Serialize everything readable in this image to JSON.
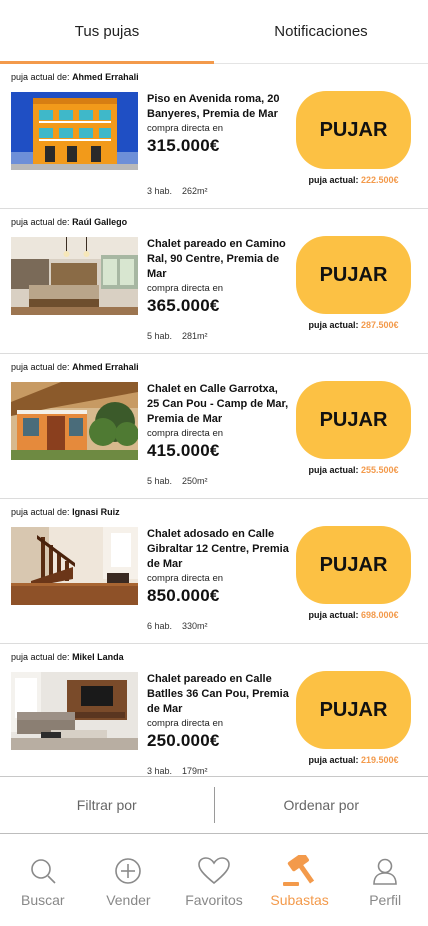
{
  "tabs": [
    {
      "label": "Tus pujas",
      "active": true
    },
    {
      "label": "Notificaciones",
      "active": false
    }
  ],
  "bidder_prefix": "puja actual de:",
  "direct_label": "compra directa en",
  "button_label": "PUJAR",
  "current_label": "puja actual:",
  "listings": [
    {
      "bidder": "Ahmed Errahali",
      "title": "Piso en Avenida roma, 20 Banyeres, Premia de Mar",
      "price": "315.000€",
      "rooms": "3 hab.",
      "area": "262m²",
      "current_bid": "222.500€",
      "photo": "orange-building"
    },
    {
      "bidder": "Raúl Gallego",
      "title": "Chalet pareado en Camino Ral, 90 Centre, Premia de Mar",
      "price": "365.000€",
      "rooms": "5 hab.",
      "area": "281m²",
      "current_bid": "287.500€",
      "photo": "kitchen"
    },
    {
      "bidder": "Ahmed Errahali",
      "title": "Chalet en Calle Garrotxa, 25 Can Pou - Camp de Mar, Premia de Mar",
      "price": "415.000€",
      "rooms": "5 hab.",
      "area": "250m²",
      "current_bid": "255.500€",
      "photo": "orange-house"
    },
    {
      "bidder": "Ignasi Ruiz",
      "title": "Chalet adosado en Calle Gibraltar 12 Centre, Premia de Mar",
      "price": "850.000€",
      "rooms": "6 hab.",
      "area": "330m²",
      "current_bid": "698.000€",
      "photo": "staircase"
    },
    {
      "bidder": "Mikel Landa",
      "title": "Chalet pareado en Calle Batlles 36 Can Pou, Premia de Mar",
      "price": "250.000€",
      "rooms": "3 hab.",
      "area": "179m²",
      "current_bid": "219.500€",
      "photo": "living-room"
    }
  ],
  "filter": {
    "filter_label": "Filtrar por",
    "sort_label": "Ordenar por"
  },
  "nav": [
    {
      "label": "Buscar",
      "icon": "search-icon",
      "active": false
    },
    {
      "label": "Vender",
      "icon": "plus-circle-icon",
      "active": false
    },
    {
      "label": "Favoritos",
      "icon": "heart-icon",
      "active": false
    },
    {
      "label": "Subastas",
      "icon": "gavel-icon",
      "active": true
    },
    {
      "label": "Perfil",
      "icon": "user-icon",
      "active": false
    }
  ],
  "colors": {
    "accent": "#f39a4b",
    "button": "#fcc144"
  }
}
